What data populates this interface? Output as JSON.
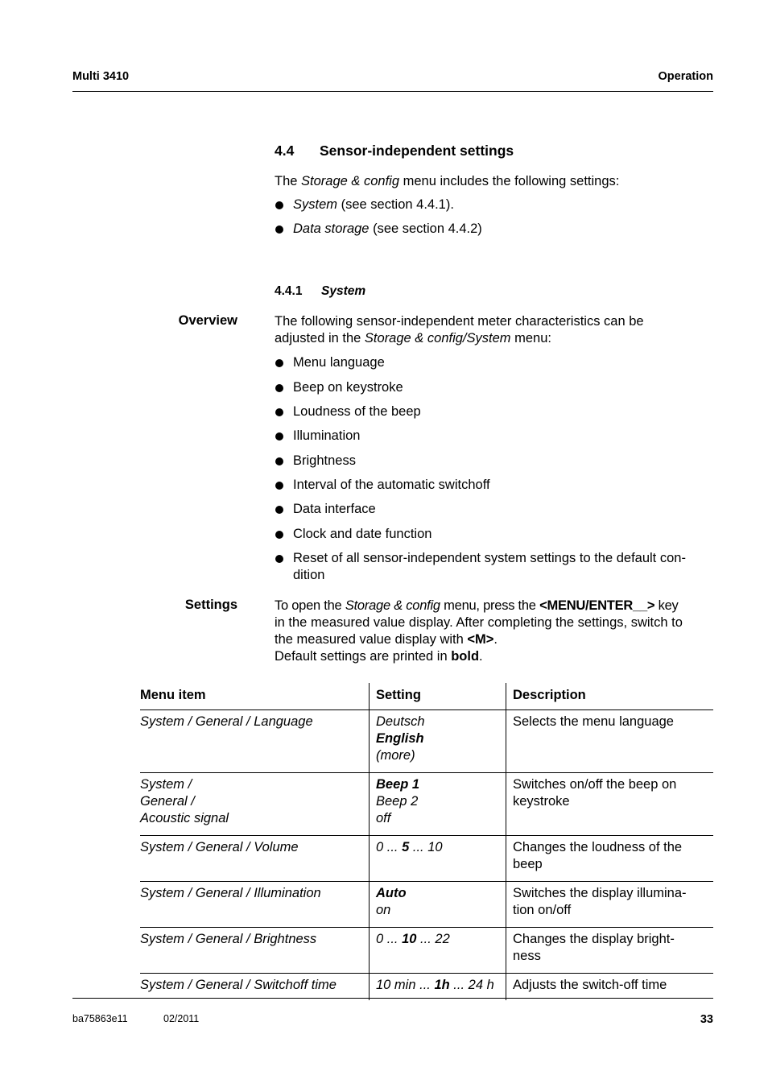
{
  "header": {
    "left": "Multi 3410",
    "right": "Operation"
  },
  "section": {
    "number": "4.4",
    "title": "Sensor-independent settings"
  },
  "intro": {
    "pre": "The ",
    "menu_italic": "Storage & config",
    "post": " menu includes the following settings:",
    "bullets": [
      {
        "italic": "System",
        "rest": " (see section 4.4.1)."
      },
      {
        "italic": "Data storage",
        "rest": " (see section 4.4.2)"
      }
    ]
  },
  "subsection": {
    "number": "4.4.1",
    "title": "System"
  },
  "overview": {
    "side_label": "Overview",
    "line1": "The following sensor-independent meter characteristics can be",
    "line2_pre": "adjusted in the ",
    "line2_italic1": "Storage & config",
    "line2_slash": "/",
    "line2_italic2": "System",
    "line2_post": " menu:",
    "bullets": [
      "Menu language",
      "Beep on keystroke",
      "Loudness of the beep",
      "Illumination",
      "Brightness",
      "Interval of the automatic switchoff",
      "Data interface",
      "Clock and date function",
      "Reset of all sensor-independent system settings to the default con-dition"
    ],
    "last_bullet_line1": "Reset of all sensor-independent system settings to the default con-",
    "last_bullet_line2": "dition"
  },
  "settings": {
    "side_label": "Settings",
    "p1_pre": "To open the ",
    "p1_italic": "Storage & config",
    "p1_mid": " menu, press the ",
    "p1_key": "<MENU/ENTER__>",
    "p1_post": " key",
    "p2": "in the measured value display. After completing the settings, switch to",
    "p3_pre": "the measured value display with ",
    "p3_key": "<M>",
    "p3_post": ".",
    "p4_pre": "Default settings are printed in ",
    "p4_bold": "bold",
    "p4_post": "."
  },
  "table": {
    "headers": [
      "Menu item",
      "Setting",
      "Description"
    ],
    "rows": [
      {
        "menu": [
          "System / General / Language"
        ],
        "setting": [
          [
            {
              "t": "Deutsch",
              "b": false
            }
          ],
          [
            {
              "t": "English",
              "b": true
            }
          ],
          [
            {
              "t": "(more)",
              "b": false
            }
          ]
        ],
        "description": [
          "Selects the menu language"
        ]
      },
      {
        "menu": [
          "System /",
          "General /",
          "Acoustic signal"
        ],
        "setting": [
          [
            {
              "t": "Beep 1",
              "b": true
            }
          ],
          [
            {
              "t": "Beep 2",
              "b": false
            }
          ],
          [
            {
              "t": "off",
              "b": false
            }
          ]
        ],
        "description": [
          "Switches on/off the beep on",
          "keystroke"
        ]
      },
      {
        "menu": [
          "System / General / Volume"
        ],
        "setting": [
          [
            {
              "t": "0 ... ",
              "b": false
            },
            {
              "t": "5",
              "b": true
            },
            {
              "t": " ... 10",
              "b": false
            }
          ]
        ],
        "description": [
          "Changes the loudness of the",
          "beep"
        ]
      },
      {
        "menu": [
          "System / General / Illumination"
        ],
        "setting": [
          [
            {
              "t": "Auto",
              "b": true
            }
          ],
          [
            {
              "t": "on",
              "b": false
            }
          ]
        ],
        "description": [
          "Switches the display illumina-",
          "tion on/off"
        ]
      },
      {
        "menu": [
          "System / General / Brightness"
        ],
        "setting": [
          [
            {
              "t": "0 ... ",
              "b": false
            },
            {
              "t": "10",
              "b": true
            },
            {
              "t": " ... 22",
              "b": false
            }
          ]
        ],
        "description": [
          "Changes the display bright-",
          "ness"
        ]
      },
      {
        "menu": [
          "System / General / Switchoff time"
        ],
        "setting": [
          [
            {
              "t": "10 min ... ",
              "b": false
            },
            {
              "t": "1h",
              "b": true
            },
            {
              "t": " ... 24 h",
              "b": false
            }
          ]
        ],
        "description": [
          "Adjusts the switch-off time"
        ]
      }
    ]
  },
  "footer": {
    "doc_id": "ba75863e11",
    "date": "02/2011",
    "page": "33"
  }
}
